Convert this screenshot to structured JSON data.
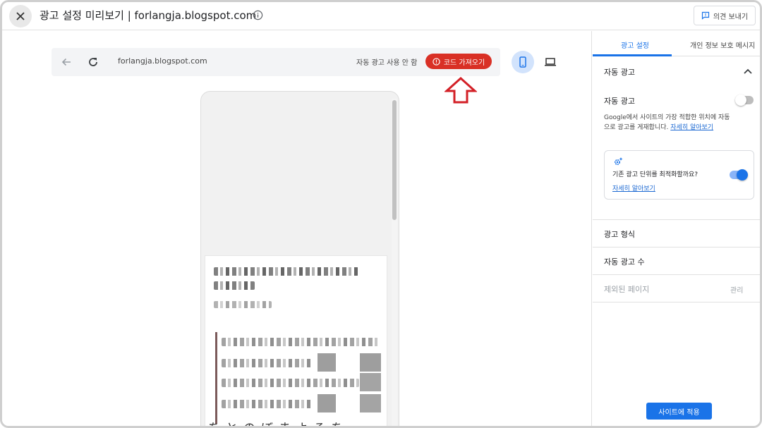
{
  "topbar": {
    "title": "광고 설정 미리보기 | forlangja.blogspot.com",
    "feedback_label": "의견 보내기"
  },
  "preview": {
    "url": "forlangja.blogspot.com",
    "status_text": "자동 광고 사용 안 함",
    "get_code_label": "코드 가져오기",
    "post_text_preview": "をとのぼまよるを"
  },
  "panel": {
    "tabs": [
      {
        "label": "광고 설정"
      },
      {
        "label": "개인 정보 보호 메시지"
      }
    ],
    "auto_ads_section": {
      "title": "자동 광고",
      "toggle_label": "자동 광고",
      "description": "Google에서 사이트의 가장 적합한 위치에 자동으로 광고를 게재합니다.",
      "learn_more": "자세히 알아보기",
      "optimize_text": "기존 광고 단위를 최적화할까요?",
      "optimize_link": "자세히 알아보기"
    },
    "rows": {
      "ad_formats": "광고 형식",
      "ad_load": "자동 광고 수",
      "excluded_pages": "제외된 페이지",
      "manage": "관리"
    },
    "apply_label": "사이트에 적용"
  },
  "colors": {
    "accent": "#1a73e8",
    "warning": "#d93025",
    "annotation_arrow": "#d32027"
  },
  "icons": [
    "close-icon",
    "info-icon",
    "feedback-icon",
    "back-arrow-icon",
    "reload-icon",
    "error-icon",
    "mobile-icon",
    "desktop-icon",
    "chevron-up-icon",
    "sparkle-settings-icon",
    "up-arrow-annotation-icon"
  ]
}
